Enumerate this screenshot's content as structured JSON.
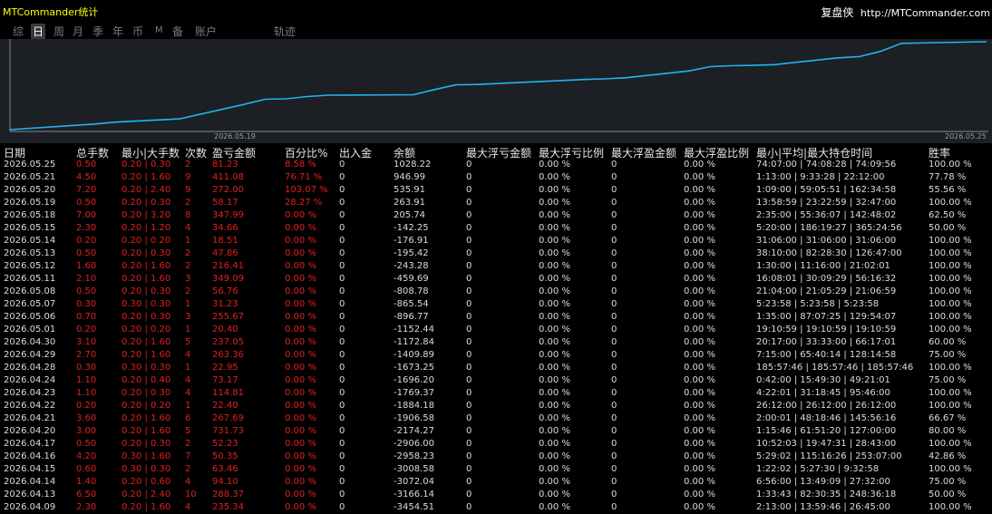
{
  "header": {
    "title": "MTCommander统计",
    "brand_name": "复盘侠",
    "brand_url": "http://MTCommander.com"
  },
  "tabs": [
    {
      "label": "综",
      "active": false
    },
    {
      "label": "日",
      "active": true
    },
    {
      "label": "周",
      "active": false
    },
    {
      "label": "月",
      "active": false
    },
    {
      "label": "季",
      "active": false
    },
    {
      "label": "年",
      "active": false
    },
    {
      "label": "币",
      "active": false
    },
    {
      "label": "M",
      "active": false
    },
    {
      "label": "备",
      "active": false
    },
    {
      "label": "账户",
      "active": false
    },
    {
      "label": "轨迹",
      "active": false
    }
  ],
  "chart_data": {
    "type": "line",
    "x_tick_labels": [
      "2026.05.19",
      "2026.05.25"
    ],
    "line_color": "#1fb6f0",
    "series": [
      {
        "x": [
          "2026.04.09",
          "2026.04.13",
          "2026.04.14",
          "2026.04.15",
          "2026.04.16",
          "2026.04.17",
          "2026.04.20",
          "2026.04.21",
          "2026.04.22",
          "2026.04.23",
          "2026.04.24",
          "2026.04.28",
          "2026.04.29",
          "2026.04.30",
          "2026.05.01",
          "2026.05.06",
          "2026.05.07",
          "2026.05.08",
          "2026.05.11",
          "2026.05.12",
          "2026.05.13",
          "2026.05.14",
          "2026.05.15",
          "2026.05.18",
          "2026.05.19",
          "2026.05.20",
          "2026.05.21",
          "2026.05.25"
        ],
        "values": [
          -3454.51,
          -3166.14,
          -3072.04,
          -3008.58,
          -2958.23,
          -2906.0,
          -2174.27,
          -1906.58,
          -1884.18,
          -1769.37,
          -1696.2,
          -1673.25,
          -1409.89,
          -1172.84,
          -1152.44,
          -896.77,
          -865.54,
          -808.78,
          -459.69,
          -243.28,
          -195.42,
          -176.91,
          -142.25,
          205.74,
          263.91,
          535.91,
          946.99,
          1028.22
        ]
      }
    ]
  },
  "columns": [
    "日期",
    "总手数",
    "最小|大手数",
    "次数",
    "盈亏金额",
    "百分比%",
    "出入金",
    "余额",
    "最大浮亏金额",
    "最大浮亏比例",
    "最大浮盈金额",
    "最大浮盈比例",
    "最小|平均|最大持仓时间",
    "胜率"
  ],
  "rows": [
    [
      "2026.05.25",
      "0.50",
      "0.20 | 0.30",
      "2",
      "81.23",
      "8.58 %",
      "0",
      "1028.22",
      "0",
      "0.00 %",
      "0",
      "0.00 %",
      "74:07:00 | 74:08:28 | 74:09:56",
      "100.00 %"
    ],
    [
      "2026.05.21",
      "4.50",
      "0.20 | 1.60",
      "9",
      "411.08",
      "76.71 %",
      "0",
      "946.99",
      "0",
      "0.00 %",
      "0",
      "0.00 %",
      "1:13:00 | 9:33:28 | 22:12:00",
      "77.78 %"
    ],
    [
      "2026.05.20",
      "7.20",
      "0.20 | 2.40",
      "9",
      "272.00",
      "103.07 %",
      "0",
      "535.91",
      "0",
      "0.00 %",
      "0",
      "0.00 %",
      "1:09:00 | 59:05:51 | 162:34:58",
      "55.56 %"
    ],
    [
      "2026.05.19",
      "0.50",
      "0.20 | 0.30",
      "2",
      "58.17",
      "28.27 %",
      "0",
      "263.91",
      "0",
      "0.00 %",
      "0",
      "0.00 %",
      "13:58:59 | 23:22:59 | 32:47:00",
      "100.00 %"
    ],
    [
      "2026.05.18",
      "7.00",
      "0.20 | 3.20",
      "8",
      "347.99",
      "0.00 %",
      "0",
      "205.74",
      "0",
      "0.00 %",
      "0",
      "0.00 %",
      "2:35:00 | 55:36:07 | 142:48:02",
      "62.50 %"
    ],
    [
      "2026.05.15",
      "2.30",
      "0.20 | 1.20",
      "4",
      "34.66",
      "0.00 %",
      "0",
      "-142.25",
      "0",
      "0.00 %",
      "0",
      "0.00 %",
      "5:20:00 | 186:19:27 | 365:24:56",
      "50.00 %"
    ],
    [
      "2026.05.14",
      "0.20",
      "0.20 | 0.20",
      "1",
      "18.51",
      "0.00 %",
      "0",
      "-176.91",
      "0",
      "0.00 %",
      "0",
      "0.00 %",
      "31:06:00 | 31:06:00 | 31:06:00",
      "100.00 %"
    ],
    [
      "2026.05.13",
      "0.50",
      "0.20 | 0.30",
      "2",
      "47.86",
      "0.00 %",
      "0",
      "-195.42",
      "0",
      "0.00 %",
      "0",
      "0.00 %",
      "38:10:00 | 82:28:30 | 126:47:00",
      "100.00 %"
    ],
    [
      "2026.05.12",
      "1.60",
      "0.20 | 1.60",
      "2",
      "216.41",
      "0.00 %",
      "0",
      "-243.28",
      "0",
      "0.00 %",
      "0",
      "0.00 %",
      "1:30:00 | 11:16:00 | 21:02:01",
      "100.00 %"
    ],
    [
      "2026.05.11",
      "2.10",
      "0.20 | 1.60",
      "3",
      "349.09",
      "0.00 %",
      "0",
      "-459.69",
      "0",
      "0.00 %",
      "0",
      "0.00 %",
      "16:08:01 | 30:09:29 | 56:16:32",
      "100.00 %"
    ],
    [
      "2026.05.08",
      "0.50",
      "0.20 | 0.30",
      "2",
      "56.76",
      "0.00 %",
      "0",
      "-808.78",
      "0",
      "0.00 %",
      "0",
      "0.00 %",
      "21:04:00 | 21:05:29 | 21:06:59",
      "100.00 %"
    ],
    [
      "2026.05.07",
      "0.30",
      "0.30 | 0.30",
      "1",
      "31.23",
      "0.00 %",
      "0",
      "-865.54",
      "0",
      "0.00 %",
      "0",
      "0.00 %",
      "5:23:58 | 5:23:58 | 5:23:58",
      "100.00 %"
    ],
    [
      "2026.05.06",
      "0.70",
      "0.20 | 0.30",
      "3",
      "255.67",
      "0.00 %",
      "0",
      "-896.77",
      "0",
      "0.00 %",
      "0",
      "0.00 %",
      "1:35:00 | 87:07:25 | 129:54:07",
      "100.00 %"
    ],
    [
      "2026.05.01",
      "0.20",
      "0.20 | 0.20",
      "1",
      "20.40",
      "0.00 %",
      "0",
      "-1152.44",
      "0",
      "0.00 %",
      "0",
      "0.00 %",
      "19:10:59 | 19:10:59 | 19:10:59",
      "100.00 %"
    ],
    [
      "2026.04.30",
      "3.10",
      "0.20 | 1.60",
      "5",
      "237.05",
      "0.00 %",
      "0",
      "-1172.84",
      "0",
      "0.00 %",
      "0",
      "0.00 %",
      "20:17:00 | 33:33:00 | 66:17:01",
      "60.00 %"
    ],
    [
      "2026.04.29",
      "2.70",
      "0.20 | 1.60",
      "4",
      "263.36",
      "0.00 %",
      "0",
      "-1409.89",
      "0",
      "0.00 %",
      "0",
      "0.00 %",
      "7:15:00 | 65:40:14 | 128:14:58",
      "75.00 %"
    ],
    [
      "2026.04.28",
      "0.30",
      "0.30 | 0.30",
      "1",
      "22.95",
      "0.00 %",
      "0",
      "-1673.25",
      "0",
      "0.00 %",
      "0",
      "0.00 %",
      "185:57:46 | 185:57:46 | 185:57:46",
      "100.00 %"
    ],
    [
      "2026.04.24",
      "1.10",
      "0.20 | 0.40",
      "4",
      "73.17",
      "0.00 %",
      "0",
      "-1696.20",
      "0",
      "0.00 %",
      "0",
      "0.00 %",
      "0:42:00 | 15:49:30 | 49:21:01",
      "75.00 %"
    ],
    [
      "2026.04.23",
      "1.10",
      "0.20 | 0.30",
      "4",
      "114.81",
      "0.00 %",
      "0",
      "-1769.37",
      "0",
      "0.00 %",
      "0",
      "0.00 %",
      "4:22:01 | 31:18:45 | 95:46:00",
      "100.00 %"
    ],
    [
      "2026.04.22",
      "0.20",
      "0.20 | 0.20",
      "1",
      "22.40",
      "0.00 %",
      "0",
      "-1884.18",
      "0",
      "0.00 %",
      "0",
      "0.00 %",
      "26:12:00 | 26:12:00 | 26:12:00",
      "100.00 %"
    ],
    [
      "2026.04.21",
      "3.60",
      "0.20 | 1.60",
      "6",
      "267.69",
      "0.00 %",
      "0",
      "-1906.58",
      "0",
      "0.00 %",
      "0",
      "0.00 %",
      "2:00:01 | 48:18:46 | 145:56:16",
      "66.67 %"
    ],
    [
      "2026.04.20",
      "3.00",
      "0.20 | 1.60",
      "5",
      "731.73",
      "0.00 %",
      "0",
      "-2174.27",
      "0",
      "0.00 %",
      "0",
      "0.00 %",
      "1:15:46 | 61:51:20 | 127:00:00",
      "80.00 %"
    ],
    [
      "2026.04.17",
      "0.50",
      "0.20 | 0.30",
      "2",
      "52.23",
      "0.00 %",
      "0",
      "-2906.00",
      "0",
      "0.00 %",
      "0",
      "0.00 %",
      "10:52:03 | 19:47:31 | 28:43:00",
      "100.00 %"
    ],
    [
      "2026.04.16",
      "4.20",
      "0.30 | 1.60",
      "7",
      "50.35",
      "0.00 %",
      "0",
      "-2958.23",
      "0",
      "0.00 %",
      "0",
      "0.00 %",
      "5:29:02 | 115:16:26 | 253:07:00",
      "42.86 %"
    ],
    [
      "2026.04.15",
      "0.60",
      "0.30 | 0.30",
      "2",
      "63.46",
      "0.00 %",
      "0",
      "-3008.58",
      "0",
      "0.00 %",
      "0",
      "0.00 %",
      "1:22:02 | 5:27:30 | 9:32:58",
      "100.00 %"
    ],
    [
      "2026.04.14",
      "1.40",
      "0.20 | 0.60",
      "4",
      "94.10",
      "0.00 %",
      "0",
      "-3072.04",
      "0",
      "0.00 %",
      "0",
      "0.00 %",
      "6:56:00 | 13:49:09 | 27:32:00",
      "75.00 %"
    ],
    [
      "2026.04.13",
      "6.50",
      "0.20 | 2.40",
      "10",
      "288.37",
      "0.00 %",
      "0",
      "-3166.14",
      "0",
      "0.00 %",
      "0",
      "0.00 %",
      "1:33:43 | 82:30:35 | 248:36:18",
      "50.00 %"
    ],
    [
      "2026.04.09",
      "2.30",
      "0.20 | 1.60",
      "4",
      "235.34",
      "0.00 %",
      "0",
      "-3454.51",
      "0",
      "0.00 %",
      "0",
      "0.00 %",
      "2:13:00 | 13:59:46 | 26:45:00",
      "100.00 %"
    ]
  ]
}
